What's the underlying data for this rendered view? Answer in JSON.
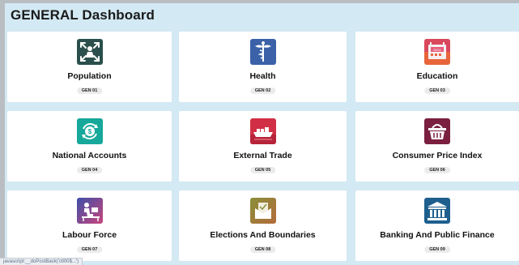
{
  "header": {
    "title": "GENERAL Dashboard"
  },
  "cards": [
    {
      "name": "Population",
      "code": "GEN 01",
      "icon": "population-arrows-icon",
      "color": "#2a4f4c"
    },
    {
      "name": "Health",
      "code": "GEN 02",
      "icon": "caduceus-icon",
      "color": "#3b62a8"
    },
    {
      "name": "Education",
      "code": "GEN 03",
      "icon": "calendar-board-icon",
      "color": "#e8653c"
    },
    {
      "name": "National Accounts",
      "code": "GEN 04",
      "icon": "dollar-cycle-icon",
      "color": "#16a89a"
    },
    {
      "name": "External Trade",
      "code": "GEN 05",
      "icon": "cargo-ship-icon",
      "color": "#d12f45"
    },
    {
      "name": "Consumer Price Index",
      "code": "GEN 06",
      "icon": "shopping-basket-icon",
      "color": "#7a1f3f"
    },
    {
      "name": "Labour Force",
      "code": "GEN 07",
      "icon": "office-worker-icon",
      "color": "#5a4a9e"
    },
    {
      "name": "Elections And Boundaries",
      "code": "GEN 08",
      "icon": "ballot-box-icon",
      "color": "#6f7a3e"
    },
    {
      "name": "Banking And Public Finance",
      "code": "GEN 09",
      "icon": "bank-building-icon",
      "color": "#1e5f8e"
    }
  ],
  "statusbar": {
    "text": "javascript:__doPostBack('ctl00$...')"
  }
}
